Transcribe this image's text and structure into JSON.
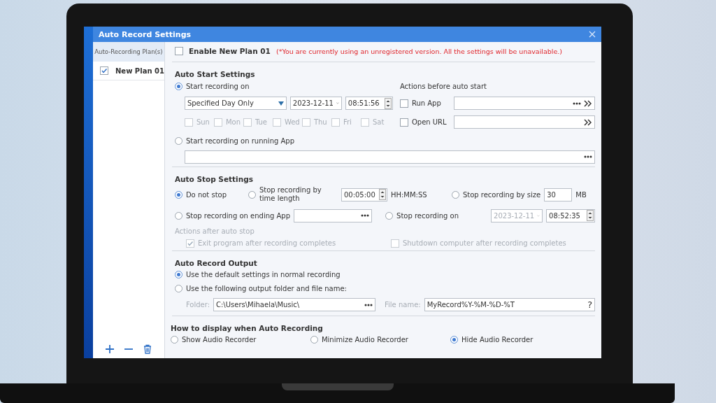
{
  "window": {
    "title": "Auto Record Settings"
  },
  "sidebar": {
    "header": "Auto-Recording Plan(s)",
    "plans": [
      {
        "label": "New Plan 01",
        "checked": true
      }
    ]
  },
  "enable": {
    "label": "Enable New Plan 01",
    "checked": false,
    "warning": "(*You are currently using an unregistered version. All the settings will be unavailable.)"
  },
  "auto_start": {
    "heading": "Auto Start Settings",
    "start_on": {
      "label": "Start recording on",
      "selected": true,
      "schedule": "Specified Day Only",
      "date": "2023-12-11",
      "time": "08:51:56"
    },
    "days": [
      {
        "label": "Sun",
        "checked": false,
        "disabled": true
      },
      {
        "label": "Mon",
        "checked": false,
        "disabled": true
      },
      {
        "label": "Tue",
        "checked": false,
        "disabled": true
      },
      {
        "label": "Wed",
        "checked": false,
        "disabled": true
      },
      {
        "label": "Thu",
        "checked": false,
        "disabled": true
      },
      {
        "label": "Fri",
        "checked": false,
        "disabled": true
      },
      {
        "label": "Sat",
        "checked": false,
        "disabled": true
      }
    ],
    "actions_heading": "Actions before auto start",
    "actions": [
      {
        "label": "Run App",
        "checked": false,
        "kind": "app"
      },
      {
        "label": "Open URL",
        "checked": false,
        "kind": "url"
      }
    ],
    "running_app": {
      "label": "Start recording on running App",
      "selected": false
    }
  },
  "auto_stop": {
    "heading": "Auto Stop Settings",
    "do_not_stop": {
      "label": "Do not stop",
      "selected": true
    },
    "by_time": {
      "label": "Stop recording by time length",
      "selected": false,
      "value": "00:05:00",
      "unit": "HH:MM:SS"
    },
    "by_size": {
      "label": "Stop recording by size",
      "selected": false,
      "value": "30",
      "unit": "MB"
    },
    "ending_app": {
      "label": "Stop recording on ending App",
      "selected": false
    },
    "stop_on": {
      "label": "Stop recording on",
      "selected": false,
      "date": "2023-12-11",
      "time": "08:52:35"
    },
    "actions_heading": "Actions after auto stop",
    "actions": [
      {
        "label": "Exit program after recording completes",
        "checked": true,
        "disabled": true
      },
      {
        "label": "Shutdown computer after recording completes",
        "checked": false,
        "disabled": true
      }
    ]
  },
  "output": {
    "heading": "Auto Record Output",
    "options": [
      {
        "label": "Use the default settings in normal recording",
        "selected": true
      },
      {
        "label": "Use the following output folder and file name:",
        "selected": false
      }
    ],
    "folder_label": "Folder:",
    "folder": "C:\\Users\\Mihaela\\Music\\",
    "file_label": "File name:",
    "file_name": "MyRecord%Y-%M-%D-%T",
    "help": "?"
  },
  "display": {
    "heading": "How to display when Auto Recording",
    "options": [
      {
        "label": "Show Audio Recorder",
        "selected": false
      },
      {
        "label": "Minimize Audio Recorder",
        "selected": false
      },
      {
        "label": "Hide Audio Recorder",
        "selected": true
      }
    ]
  }
}
